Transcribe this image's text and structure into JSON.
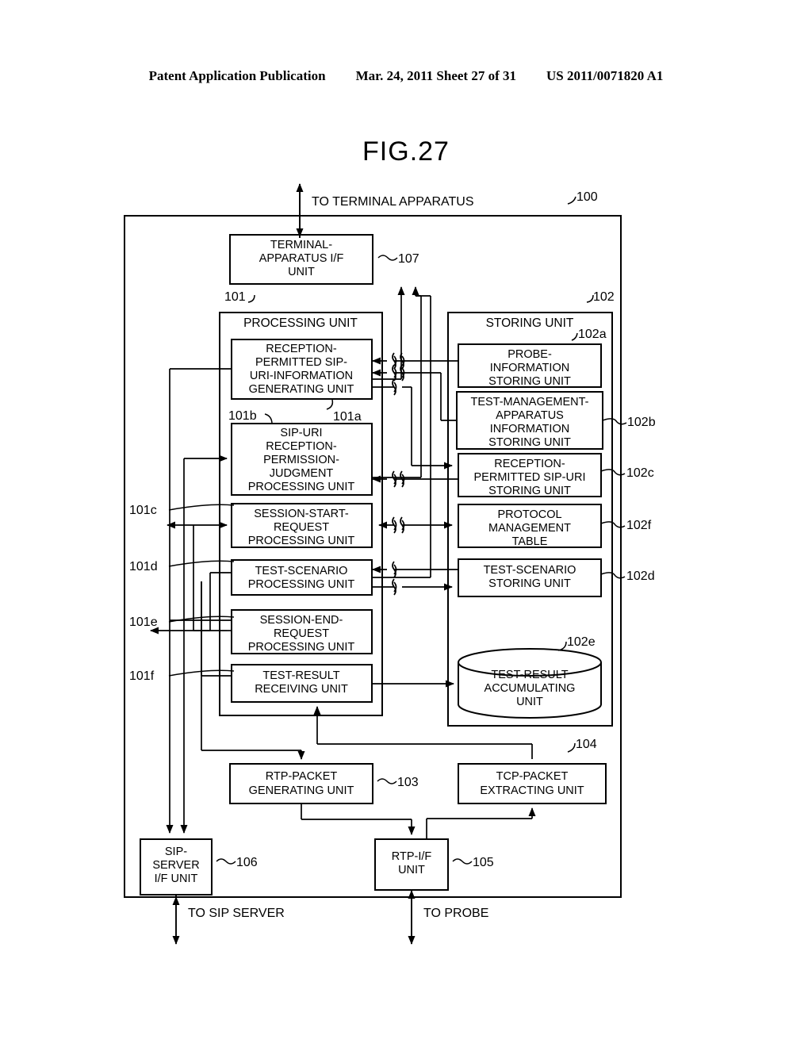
{
  "header": {
    "publication": "Patent Application Publication",
    "date": "Mar. 24, 2011",
    "sheet": "Sheet 27 of 31",
    "number": "US 2011/0071820 A1"
  },
  "figure": {
    "title": "FIG.27"
  },
  "external_labels": {
    "top": "TO TERMINAL APPARATUS",
    "bottom_left": "TO SIP SERVER",
    "bottom_right": "TO PROBE"
  },
  "blocks": {
    "outer": {
      "ref": "100",
      "label": ""
    },
    "terminal_if": {
      "ref": "107",
      "lines": [
        "TERMINAL-",
        "APPARATUS I/F",
        "UNIT"
      ]
    },
    "processing_unit": {
      "ref": "101",
      "lines": [
        "PROCESSING UNIT"
      ]
    },
    "storing_unit": {
      "ref": "102",
      "lines": [
        "STORING UNIT"
      ]
    },
    "sip_uri_info_gen": {
      "ref": "101a",
      "lines": [
        "RECEPTION-",
        "PERMITTED SIP-",
        "URI-INFORMATION",
        "GENERATING UNIT"
      ]
    },
    "sip_uri_judgment": {
      "ref": "101b",
      "lines": [
        "SIP-URI",
        "RECEPTION-",
        "PERMISSION-",
        "JUDGMENT",
        "PROCESSING UNIT"
      ]
    },
    "session_start": {
      "ref": "101c",
      "lines": [
        "SESSION-START-",
        "REQUEST",
        "PROCESSING UNIT"
      ]
    },
    "test_scenario_proc": {
      "ref": "101d",
      "lines": [
        "TEST-SCENARIO",
        "PROCESSING UNIT"
      ]
    },
    "session_end": {
      "ref": "101e",
      "lines": [
        "SESSION-END-",
        "REQUEST",
        "PROCESSING UNIT"
      ]
    },
    "test_result_recv": {
      "ref": "101f",
      "lines": [
        "TEST-RESULT",
        "RECEIVING UNIT"
      ]
    },
    "probe_info": {
      "ref": "102a",
      "lines": [
        "PROBE-",
        "INFORMATION",
        "STORING UNIT"
      ]
    },
    "test_mgmt_info": {
      "ref": "102b",
      "lines": [
        "TEST-MANAGEMENT-",
        "APPARATUS",
        "INFORMATION",
        "STORING UNIT"
      ]
    },
    "recv_permitted": {
      "ref": "102c",
      "lines": [
        "RECEPTION-",
        "PERMITTED SIP-URI",
        "STORING UNIT"
      ]
    },
    "protocol_table": {
      "ref": "102f",
      "lines": [
        "PROTOCOL",
        "MANAGEMENT",
        "TABLE"
      ]
    },
    "test_scenario_store": {
      "ref": "102d",
      "lines": [
        "TEST-SCENARIO",
        "STORING UNIT"
      ]
    },
    "test_result_accum": {
      "ref": "102e",
      "lines": [
        "TEST-RESULT",
        "ACCUMULATING",
        "UNIT"
      ]
    },
    "rtp_packet_gen": {
      "ref": "103",
      "lines": [
        "RTP-PACKET",
        "GENERATING UNIT"
      ]
    },
    "tcp_packet_extract": {
      "ref": "104",
      "lines": [
        "TCP-PACKET",
        "EXTRACTING UNIT"
      ]
    },
    "rtp_if": {
      "ref": "105",
      "lines": [
        "RTP-I/F",
        "UNIT"
      ]
    },
    "sip_server_if": {
      "ref": "106",
      "lines": [
        "SIP-",
        "SERVER",
        "I/F UNIT"
      ]
    }
  },
  "colors": {
    "ink": "#000000",
    "paper": "#ffffff"
  }
}
